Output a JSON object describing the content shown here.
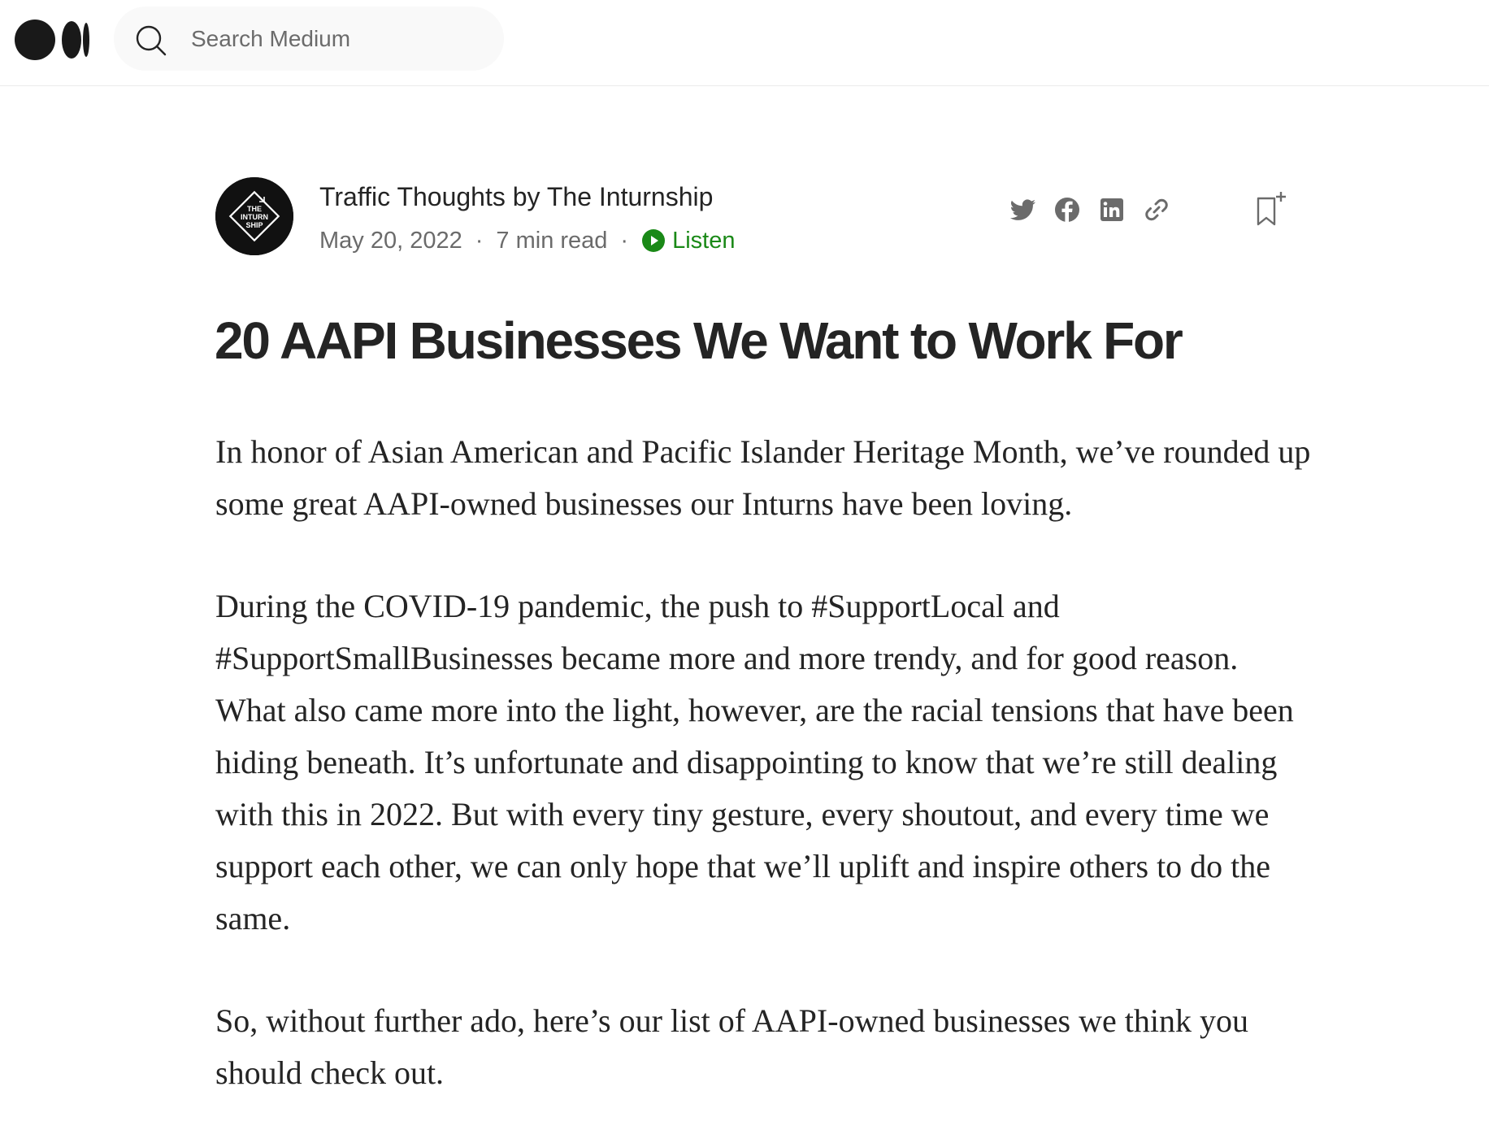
{
  "topbar": {
    "logo_icon": "medium-logo-icon",
    "search": {
      "placeholder": "Search Medium",
      "value": "",
      "icon": "search-icon"
    }
  },
  "article": {
    "publication": "Traffic Thoughts by The Inturnship",
    "avatar_text": [
      "THE",
      "INTURN",
      "SHIP"
    ],
    "date": "May 20, 2022",
    "separator": "·",
    "read_time": "7 min read",
    "listen_label": "Listen",
    "listen_color": "#1a8917",
    "share_icons": [
      "twitter-icon",
      "facebook-icon",
      "linkedin-icon",
      "link-icon"
    ],
    "bookmark_icon": "bookmark-add-icon",
    "title": "20 AAPI Businesses We Want to Work For",
    "paragraphs": [
      "In honor of Asian American and Pacific Islander Heritage Month, we’ve rounded up some great AAPI-owned businesses our Inturns have been loving.",
      "During the COVID-19 pandemic, the push to #SupportLocal and #SupportSmallBusinesses became more and more trendy, and for good reason. What also came more into the light, however, are the racial tensions that have been hiding beneath. It’s unfortunate and disappointing to know that we’re still dealing with this in 2022. But with every tiny gesture, every shoutout, and every time we support each other, we can only hope that we’ll uplift and inspire others to do the same.",
      "So, without further ado, here’s our list of AAPI-owned businesses we think you should check out."
    ]
  }
}
